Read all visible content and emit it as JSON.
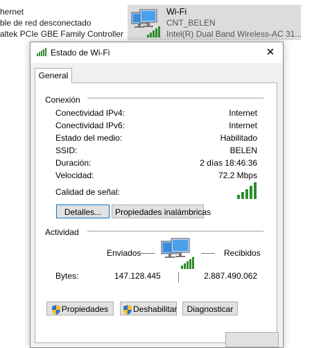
{
  "background": {
    "ethernet": {
      "name_fragment": "hernet",
      "status_fragment": "ble de red desconectado",
      "adapter_fragment": "altek PCIe GBE Family Controller"
    },
    "wifi": {
      "name": "Wi-Fi",
      "ssid": "CNT_BELEN",
      "adapter": "Intel(R) Dual Band Wireless-AC 31..."
    }
  },
  "dialog": {
    "title": "Estado de Wi-Fi",
    "close": "✕",
    "tab": "General",
    "connection_heading": "Conexión",
    "rows": [
      {
        "label": "Conectividad IPv4:",
        "value": "Internet"
      },
      {
        "label": "Conectividad IPv6:",
        "value": "Internet"
      },
      {
        "label": "Estado del medio:",
        "value": "Habilitado"
      },
      {
        "label": "SSID:",
        "value": "BELEN"
      },
      {
        "label": "Duración:",
        "value": "2 días 18:46:36"
      },
      {
        "label": "Velocidad:",
        "value": "72,2 Mbps"
      }
    ],
    "signal_label": "Calidad de señal:",
    "signal_bars": 5,
    "details_button": "Detalles...",
    "wireless_props_button": "Propiedades inalámbricas",
    "activity_heading": "Actividad",
    "sent_label": "Enviados",
    "received_label": "Recibidos",
    "bytes_label": "Bytes:",
    "bytes_sent": "147.128.445",
    "bytes_received": "2.887.490.062",
    "properties_button": "Propiedades",
    "disable_button": "Deshabilitar",
    "diagnose_button": "Diagnosticar"
  },
  "colors": {
    "signal_green": "#2e8b2e",
    "focus_blue": "#0078d7",
    "monitor_blue": "#3a8ee0"
  }
}
